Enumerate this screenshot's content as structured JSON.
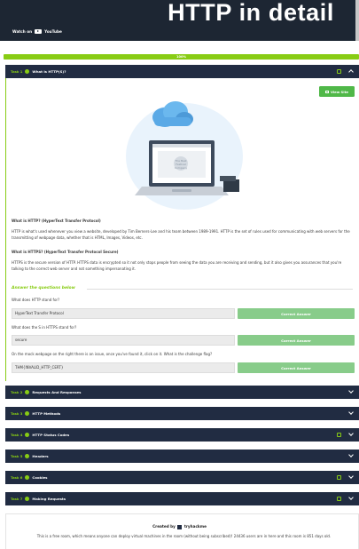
{
  "banner": {
    "title": "HTTP in detail",
    "watch_on": "Watch on",
    "youtube": "YouTube"
  },
  "progress": {
    "value_percent": 100,
    "label": "100%"
  },
  "tasks": [
    {
      "num": "Task 1",
      "name": "What is HTTP(S)?",
      "expanded": true,
      "has_flag": true
    },
    {
      "num": "Task 2",
      "name": "Requests And Responses",
      "expanded": false,
      "has_flag": false
    },
    {
      "num": "Task 3",
      "name": "HTTP Methods",
      "expanded": false,
      "has_flag": false
    },
    {
      "num": "Task 4",
      "name": "HTTP Status Codes",
      "expanded": false,
      "has_flag": true
    },
    {
      "num": "Task 5",
      "name": "Headers",
      "expanded": false,
      "has_flag": false
    },
    {
      "num": "Task 6",
      "name": "Cookies",
      "expanded": false,
      "has_flag": true
    },
    {
      "num": "Task 7",
      "name": "Making Requests",
      "expanded": false,
      "has_flag": true
    }
  ],
  "task1": {
    "view_site": "View Site",
    "illustration_screen_text": "The Best Festival Company",
    "h1": "What is HTTP? (HyperText Transfer Protocol)",
    "p1": "HTTP is what's used whenever you view a website, developed by Tim Berners-Lee and his team between 1989-1991. HTTP is the set of rules used for communicating with web servers for the transmitting of webpage data, whether that is HTML, Images, Videos, etc.",
    "h2": "What is HTTPS? (HyperText Transfer Protocol Secure)",
    "p2": "HTTPS is the secure version of HTTP. HTTPS data is encrypted so it not only stops people from seeing the data you are receiving and sending, but it also gives you assurances that you're talking to the correct web server and not something impersonating it.",
    "answer_heading": "Answer the questions below",
    "questions": [
      {
        "q": "What does HTTP stand for?",
        "answer": "HyperText Transfer Protocol",
        "button": "Correct Answer"
      },
      {
        "q": "What does the S in HTTPS stand for?",
        "answer": "secure",
        "button": "Correct Answer"
      },
      {
        "q": "On the mock webpage on the right there is an issue, once you've found it, click on it. What is the challenge flag?",
        "answer": "THM{INVALID_HTTP_CERT}",
        "button": "Correct Answer"
      }
    ]
  },
  "footer": {
    "created_by": "Created by",
    "author": "tryhackme",
    "free_text": "This is a free room, which means anyone can deploy virtual machines in the room (without being subscribed)! 24436 users are in here and this room is 851 days old."
  },
  "colors": {
    "accent_green": "#88cc14",
    "task_header_bg": "#212c42",
    "correct_button": "#88cc8a",
    "view_site_button": "#50b848"
  }
}
